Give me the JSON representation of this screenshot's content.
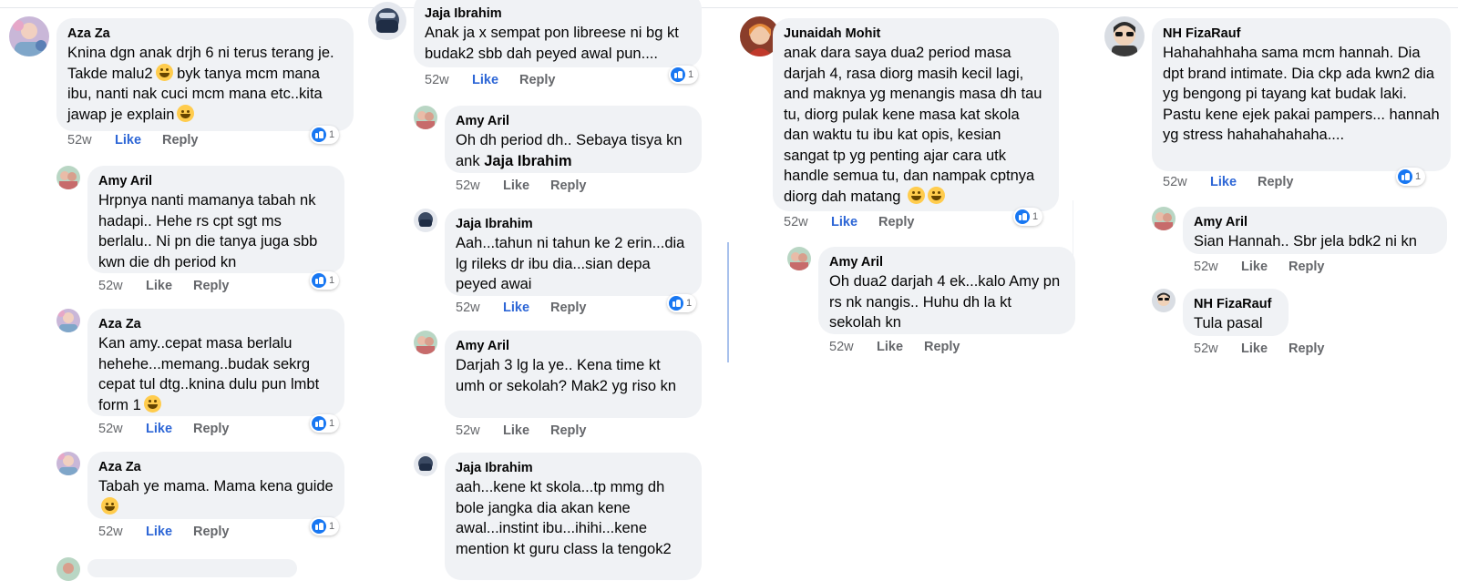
{
  "colors": {
    "bubble": "#f0f2f5",
    "like_active": "#2d66d6",
    "meta_gray": "#65676b",
    "reaction_blue": "#1877f2"
  },
  "icons": {
    "reaction": "like-thumb-icon",
    "emoji_grin": "grinning-face-icon",
    "emoji_tears": "crying-face-icon"
  },
  "comments": {
    "c1": {
      "author": "Aza Za",
      "text": "Knina dgn anak drjh 6 ni terus terang je. Takde malu2",
      "text2": "byk tanya mcm mana ibu, nanti nak cuci mcm mana etc..kita jawap je explain",
      "time": "52w",
      "like": "Like",
      "reply": "Reply",
      "count": "1"
    },
    "c2": {
      "author": "Amy Aril",
      "text": "Hrpnya nanti mamanya tabah nk hadapi.. Hehe rs cpt sgt ms berlalu.. Ni pn die tanya juga sbb kwn die dh period kn",
      "time": "52w",
      "like": "Like",
      "reply": "Reply",
      "count": "1"
    },
    "c3": {
      "author": "Aza Za",
      "text": "Kan amy..cepat masa berlalu hehehe...memang..budak sekrg cepat tul dtg..knina dulu pun lmbt form 1",
      "time": "52w",
      "like": "Like",
      "reply": "Reply",
      "count": "1"
    },
    "c4": {
      "author": "Aza Za",
      "text": "Tabah ye mama. Mama kena guide",
      "time": "52w",
      "like": "Like",
      "reply": "Reply",
      "count": "1"
    },
    "c5": {
      "author": "Jaja Ibrahim",
      "text": "Anak ja x sempat pon libreese ni bg kt budak2 sbb dah peyed awal pun....",
      "time": "52w",
      "like": "Like",
      "reply": "Reply",
      "count": "1"
    },
    "c6": {
      "author": "Amy Aril",
      "text": "Oh dh period dh.. Sebaya tisya kn ank",
      "mention": "Jaja Ibrahim",
      "time": "52w",
      "like": "Like",
      "reply": "Reply"
    },
    "c7": {
      "author": "Jaja Ibrahim",
      "text": "Aah...tahun ni tahun ke 2 erin...dia lg rileks dr ibu dia...sian depa peyed awai",
      "time": "52w",
      "like": "Like",
      "reply": "Reply",
      "count": "1"
    },
    "c8": {
      "author": "Amy Aril",
      "text": "Darjah 3 lg la ye.. Kena time kt umh or sekolah? Mak2 yg riso kn",
      "time": "52w",
      "like": "Like",
      "reply": "Reply"
    },
    "c9": {
      "author": "Jaja Ibrahim",
      "text": "aah...kene kt skola...tp mmg dh bole jangka dia akan kene awal...instint ibu...ihihi...kene mention kt guru class la tengok2"
    },
    "c10": {
      "author": "Junaidah Mohit",
      "text": "anak dara saya dua2 period masa darjah 4, rasa diorg masih kecil lagi, and maknya yg menangis masa dh tau tu, diorg pulak kene masa kat skola dan waktu tu ibu kat opis, kesian sangat tp yg penting ajar cara utk handle semua tu, dan nampak cptnya diorg dah matang",
      "time": "52w",
      "like": "Like",
      "reply": "Reply",
      "count": "1"
    },
    "c11": {
      "author": "Amy Aril",
      "text": "Oh dua2 darjah 4 ek...kalo Amy pn rs nk nangis.. Huhu dh la kt sekolah kn",
      "time": "52w",
      "like": "Like",
      "reply": "Reply"
    },
    "c12": {
      "author": "NH FizaRauf",
      "text": "Hahahahhaha sama mcm hannah. Dia dpt brand intimate. Dia ckp ada kwn2 dia yg bengong pi tayang kat budak laki. Pastu kene ejek pakai pampers... hannah yg stress hahahahahaha....",
      "time": "52w",
      "like": "Like",
      "reply": "Reply",
      "count": "1"
    },
    "c13": {
      "author": "Amy Aril",
      "text": "Sian Hannah.. Sbr jela bdk2 ni kn",
      "time": "52w",
      "like": "Like",
      "reply": "Reply"
    },
    "c14": {
      "author": "NH FizaRauf",
      "text": "Tula pasal",
      "time": "52w",
      "like": "Like",
      "reply": "Reply"
    }
  }
}
